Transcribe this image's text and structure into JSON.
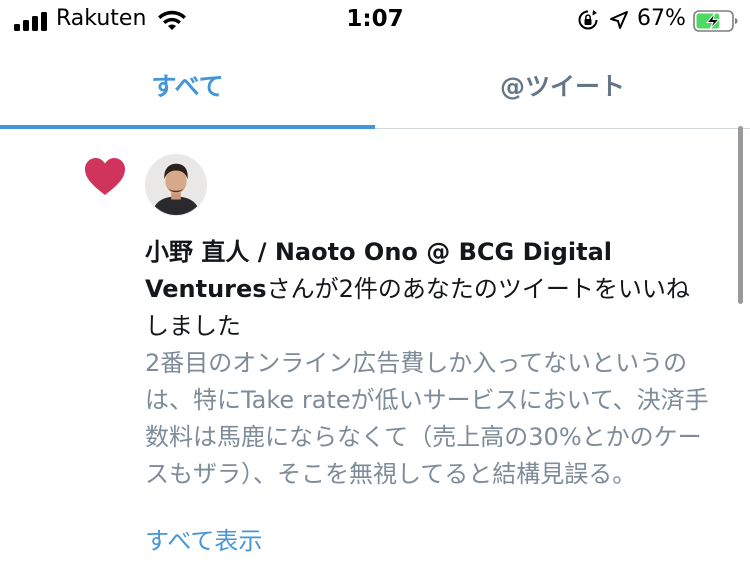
{
  "status_bar": {
    "carrier": "Rakuten",
    "time": "1:07",
    "battery_percent": "67%",
    "battery_level": 0.67,
    "icons": [
      "signal-icon",
      "wifi-icon",
      "rotation-lock-icon",
      "location-icon",
      "battery-charging-icon"
    ]
  },
  "tabs": [
    {
      "label": "すべて",
      "active": true
    },
    {
      "label": "@ツイート",
      "active": false
    }
  ],
  "colors": {
    "accent": "#4596d8",
    "heart": "#d0345d",
    "secondary_text": "#7e8c99"
  },
  "notification": {
    "icon": "heart-icon",
    "user_name": "小野 直人 / Naoto Ono @ BCG Digital Ventures",
    "action_text": "さんが2件のあなたのツイートをいいねしました",
    "tweet_preview": "2番目のオンライン広告費しか入ってないというのは、特にTake rateが低いサービスにおいて、決済手数料は馬鹿にならなくて（売上高の30%とかのケースもザラ）、そこを無視してると結構見誤る。",
    "show_all_label": "すべて表示"
  }
}
